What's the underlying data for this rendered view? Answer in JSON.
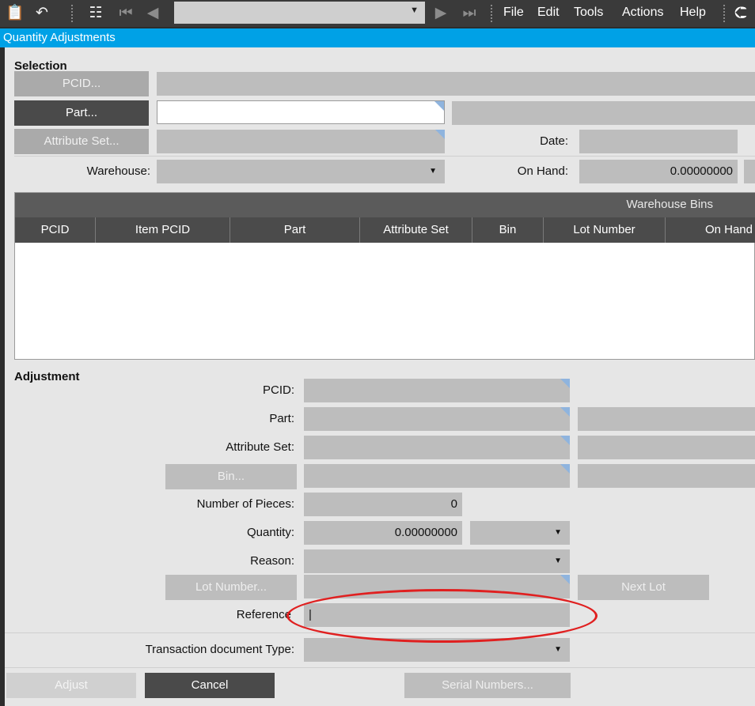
{
  "toolbar": {
    "menu": [
      "File",
      "Edit",
      "Tools",
      "Actions",
      "Help"
    ],
    "nav_value": ""
  },
  "window": {
    "title": "Quantity Adjustments"
  },
  "selection": {
    "section_label": "Selection",
    "pcid_button": "PCID...",
    "pcid_value": "",
    "part_button": "Part...",
    "part_value": "",
    "part_description": "",
    "attribute_set_button": "Attribute Set...",
    "attribute_set_value": "",
    "date_label": "Date:",
    "date_value": "",
    "warehouse_label": "Warehouse:",
    "warehouse_value": "",
    "on_hand_label": "On Hand:",
    "on_hand_value": "0.00000000"
  },
  "grid": {
    "group_header": "Warehouse Bins",
    "columns": [
      "PCID",
      "Item PCID",
      "Part",
      "Attribute Set",
      "Bin",
      "Lot Number",
      "On Hand"
    ],
    "rows": []
  },
  "adjustment": {
    "section_label": "Adjustment",
    "pcid_label": "PCID:",
    "pcid_value": "",
    "part_label": "Part:",
    "part_value": "",
    "part_description": "",
    "attribute_set_label": "Attribute Set:",
    "attribute_set_value": "",
    "attribute_set_description": "",
    "bin_button": "Bin...",
    "bin_value": "",
    "bin_description": "",
    "pieces_label": "Number of Pieces:",
    "pieces_value": "0",
    "quantity_label": "Quantity:",
    "quantity_value": "0.00000000",
    "uom_value": "",
    "reason_label": "Reason:",
    "reason_value": "",
    "lot_button": "Lot Number...",
    "lot_value": "",
    "next_lot_button": "Next Lot",
    "reference_label": "Reference",
    "reference_value": "|"
  },
  "transaction": {
    "label": "Transaction document Type:",
    "value": ""
  },
  "footer": {
    "adjust_button": "Adjust",
    "cancel_button": "Cancel",
    "serial_button": "Serial Numbers..."
  },
  "colors": {
    "title_bar": "#00a1e6",
    "toolbar": "#3a3a3a",
    "annotation": "#e02020"
  }
}
